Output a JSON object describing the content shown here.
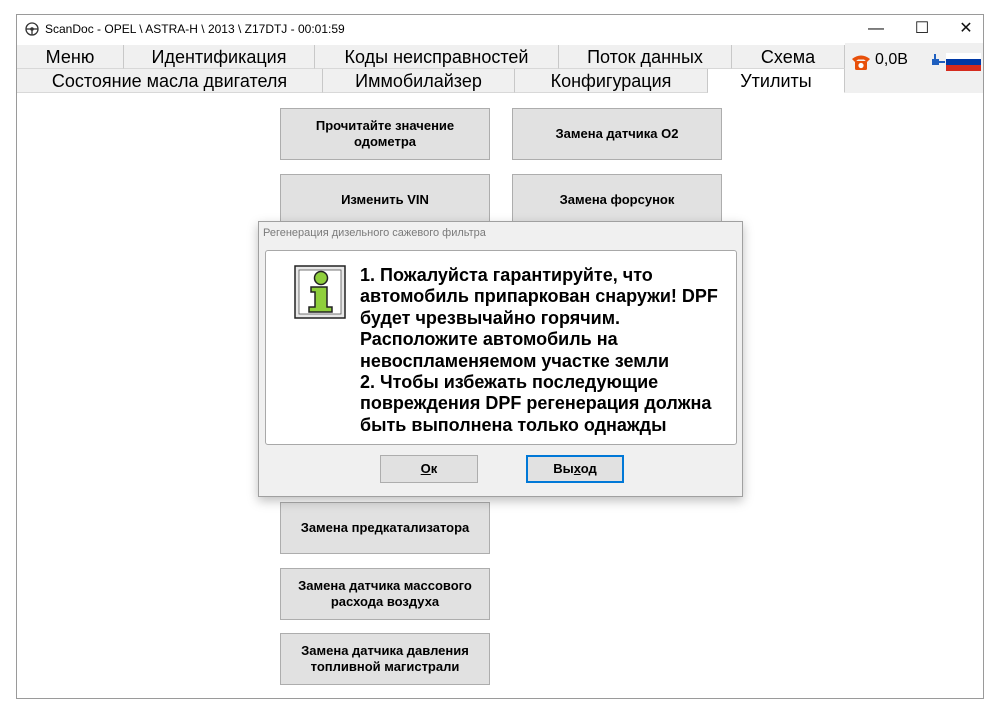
{
  "window": {
    "title": "ScanDoc - OPEL \\ ASTRA-H \\ 2013 \\ Z17DTJ - 00:01:59",
    "minimize_glyph": "—",
    "maximize_glyph": "☐",
    "close_glyph": "✕"
  },
  "tabs_row1": [
    "Меню",
    "Идентификация",
    "Коды неисправностей",
    "Поток данных",
    "Схема"
  ],
  "tabs_row2": [
    "Состояние масла двигателя",
    "Иммобилайзер",
    "Конфигурация",
    "Утилиты"
  ],
  "active_tab": "Утилиты",
  "status": {
    "voltage": "0,0В",
    "phone_icon": "phone-icon",
    "plug_icon": "plug-icon",
    "flag_icon": "russian-flag-icon"
  },
  "utilities": {
    "left": [
      "Прочитайте значение одометра",
      "Изменить VIN",
      "Замена предкатализатора",
      "Замена датчика массового расхода воздуха",
      "Замена датчика давления топливной магистрали"
    ],
    "right": [
      "Замена датчика O2",
      "Замена форсунок"
    ]
  },
  "dialog": {
    "title": "Регенерация дизельного сажевого фильтра",
    "message_lines": [
      "1. Пожалуйста гарантируйте, что",
      "автомобиль припаркован снаружи! DPF",
      "будет чрезвычайно горячим.",
      "Расположите автомобиль на",
      "невоспламеняемом участке земли",
      "2. Чтобы избежать последующие",
      "повреждения DPF регенерация должна",
      "быть выполнена только однажды"
    ],
    "ok_mnemonic": "О",
    "ok_rest": "к",
    "exit_before": "Вы",
    "exit_mnemonic": "х",
    "exit_after": "од",
    "icon": "info-icon"
  },
  "colors": {
    "accent": "#0078d7",
    "phone": "#e8500a",
    "flag_white": "#ffffff",
    "flag_blue": "#0039a6",
    "flag_red": "#d52b1e"
  }
}
